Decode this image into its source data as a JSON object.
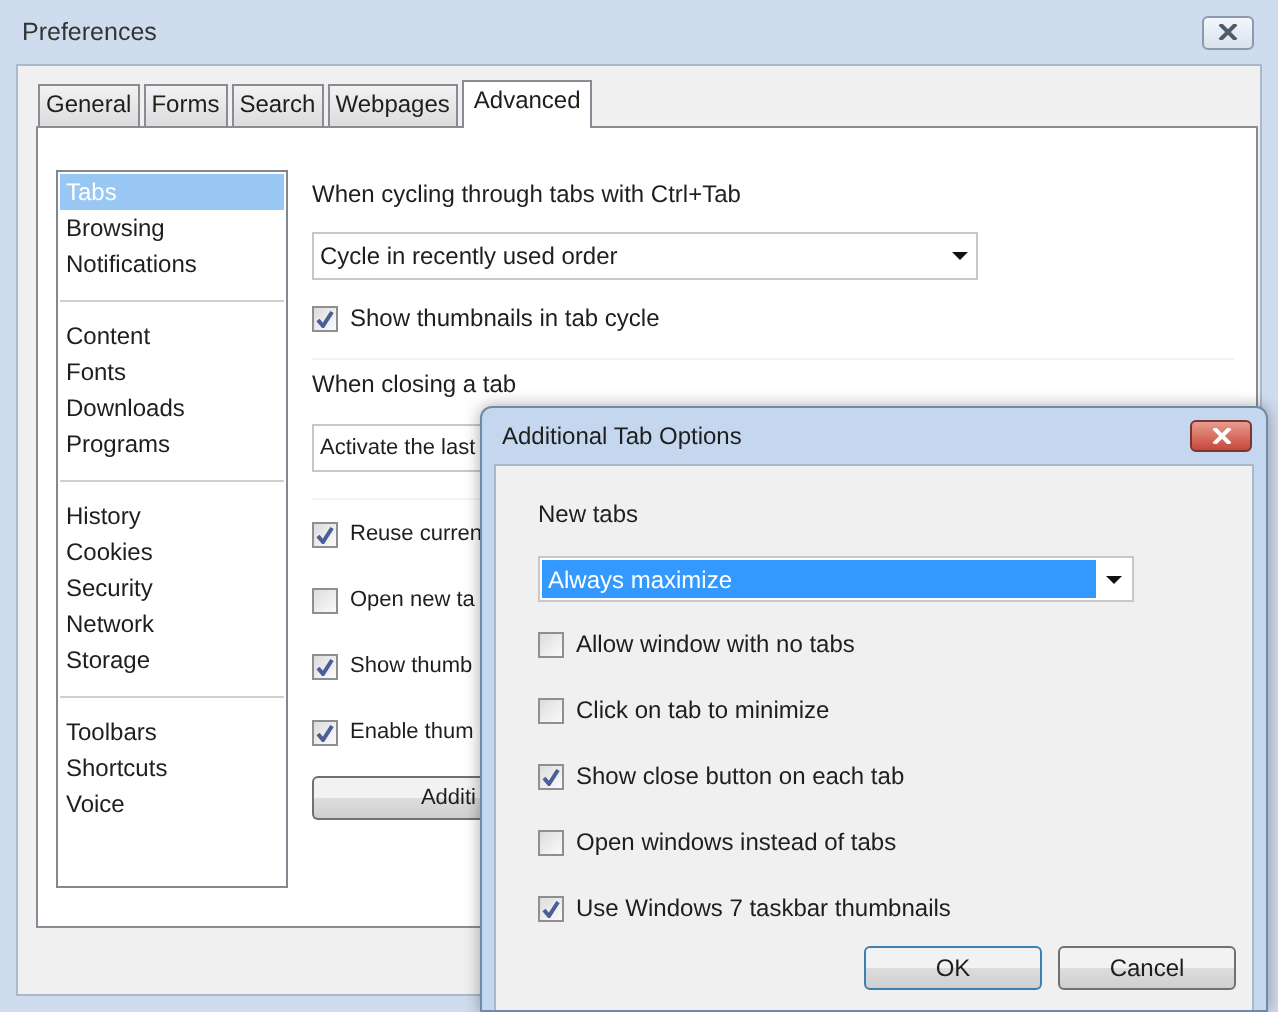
{
  "window": {
    "title": "Preferences"
  },
  "tabs": [
    {
      "label": "General",
      "selected": false
    },
    {
      "label": "Forms",
      "selected": false
    },
    {
      "label": "Search",
      "selected": false
    },
    {
      "label": "Webpages",
      "selected": false
    },
    {
      "label": "Advanced",
      "selected": true
    }
  ],
  "sidebar": {
    "groups": [
      {
        "items": [
          {
            "label": "Tabs",
            "selected": true
          },
          {
            "label": "Browsing",
            "selected": false
          },
          {
            "label": "Notifications",
            "selected": false
          }
        ]
      },
      {
        "items": [
          {
            "label": "Content",
            "selected": false
          },
          {
            "label": "Fonts",
            "selected": false
          },
          {
            "label": "Downloads",
            "selected": false
          },
          {
            "label": "Programs",
            "selected": false
          }
        ]
      },
      {
        "items": [
          {
            "label": "History",
            "selected": false
          },
          {
            "label": "Cookies",
            "selected": false
          },
          {
            "label": "Security",
            "selected": false
          },
          {
            "label": "Network",
            "selected": false
          },
          {
            "label": "Storage",
            "selected": false
          }
        ]
      },
      {
        "items": [
          {
            "label": "Toolbars",
            "selected": false
          },
          {
            "label": "Shortcuts",
            "selected": false
          },
          {
            "label": "Voice",
            "selected": false
          }
        ]
      }
    ]
  },
  "tab_cycling": {
    "heading": "When cycling through tabs with Ctrl+Tab",
    "select": {
      "value": "Cycle in recently used order",
      "focused": false
    },
    "option": {
      "label": "Show thumbnails in tab cycle",
      "checked": true
    }
  },
  "tab_closing": {
    "heading": "When closing a tab",
    "select": {
      "value": "Activate the last",
      "focused": false
    },
    "options": [
      {
        "label": "Reuse curren",
        "checked": true
      },
      {
        "label": "Open new ta",
        "checked": false
      },
      {
        "label": "Show thumb",
        "checked": true
      },
      {
        "label": "Enable thum",
        "checked": true
      }
    ],
    "button": "Additi"
  },
  "dialog": {
    "title": "Additional Tab Options",
    "section_label": "New tabs",
    "select": {
      "value": "Always maximize",
      "focused": true
    },
    "options": [
      {
        "label": "Allow window with no tabs",
        "checked": false
      },
      {
        "label": "Click on tab to minimize",
        "checked": false
      },
      {
        "label": "Show close button on each tab",
        "checked": true
      },
      {
        "label": "Open windows instead of tabs",
        "checked": false
      },
      {
        "label": "Use Windows 7 taskbar thumbnails",
        "checked": true
      }
    ],
    "buttons": [
      "OK",
      "Cancel"
    ]
  }
}
